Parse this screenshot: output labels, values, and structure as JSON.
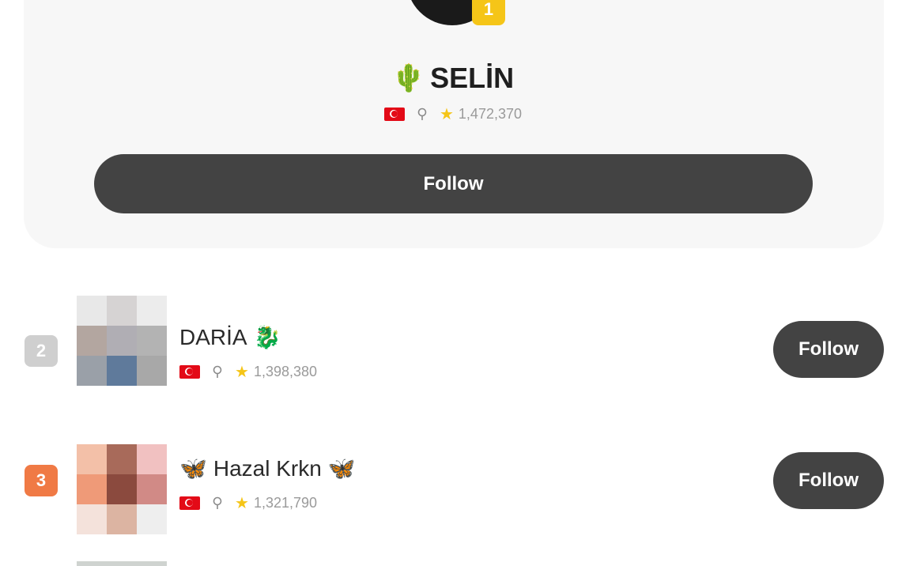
{
  "top_user": {
    "rank": "1",
    "name_emoji": "🌵",
    "name": "SELİN",
    "score": "1,472,370",
    "follow_label": "Follow",
    "rank_color": "#f5c518"
  },
  "list": [
    {
      "rank": "2",
      "name_prefix_emoji": "",
      "name": "DARİA",
      "name_suffix_emoji": "🐉",
      "score": "1,398,380",
      "follow_label": "Follow",
      "rank_color": "#cfcfcf",
      "avatar_colors": [
        "#e8e8e8",
        "#d6d3d3",
        "#ececec",
        "#b3a6a0",
        "#b0aeb4",
        "#b3b3b3",
        "#9aa0a8",
        "#5f7a9b",
        "#a8a8a8"
      ]
    },
    {
      "rank": "3",
      "name_prefix_emoji": "🦋",
      "name": "Hazal Krkn",
      "name_suffix_emoji": "🦋",
      "score": "1,321,790",
      "follow_label": "Follow",
      "rank_color": "#f07a45",
      "avatar_colors": [
        "#f3c0a8",
        "#a86a5a",
        "#f1c1c1",
        "#ef9a78",
        "#8b4a3e",
        "#d18a86",
        "#f4e2db",
        "#dcb4a2",
        "#eeeeee"
      ]
    }
  ],
  "icons": {
    "flag": "turkey-flag-icon",
    "location": "location-pin-icon",
    "score": "star-icon"
  }
}
